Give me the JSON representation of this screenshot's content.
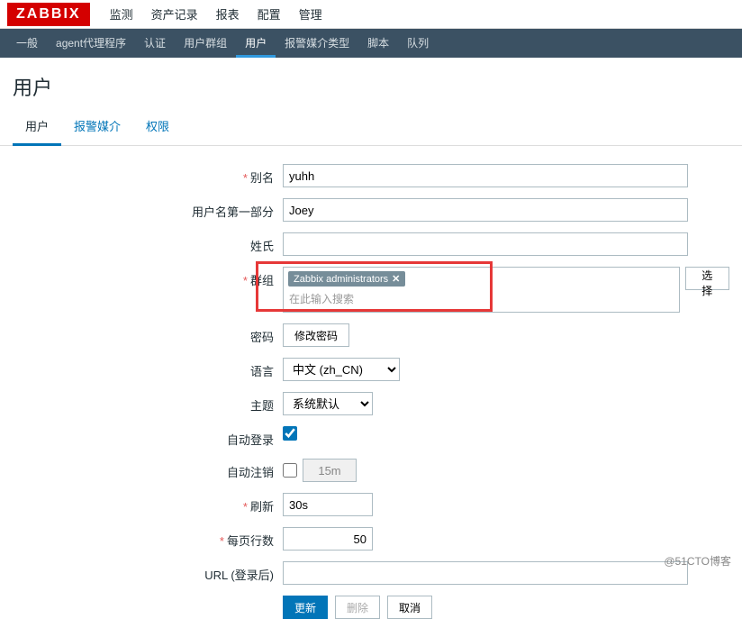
{
  "logo": "ZABBIX",
  "top_menu": {
    "items": [
      "监测",
      "资产记录",
      "报表",
      "配置",
      "管理"
    ],
    "active_index": 4
  },
  "sub_menu": {
    "items": [
      "一般",
      "agent代理程序",
      "认证",
      "用户群组",
      "用户",
      "报警媒介类型",
      "脚本",
      "队列"
    ],
    "active_index": 4
  },
  "page_title": "用户",
  "tabs": {
    "items": [
      "用户",
      "报警媒介",
      "权限"
    ],
    "active_index": 0
  },
  "form": {
    "alias": {
      "label": "别名",
      "value": "yuhh",
      "required": true
    },
    "name_first": {
      "label": "用户名第一部分",
      "value": "Joey"
    },
    "surname": {
      "label": "姓氏",
      "value": ""
    },
    "groups": {
      "label": "群组",
      "required": true,
      "selected": [
        {
          "name": "Zabbix administrators"
        }
      ],
      "placeholder": "在此输入搜索",
      "select_btn": "选择"
    },
    "password": {
      "label": "密码",
      "change_btn": "修改密码"
    },
    "language": {
      "label": "语言",
      "value": "中文 (zh_CN)",
      "options": [
        "中文 (zh_CN)"
      ]
    },
    "theme": {
      "label": "主题",
      "value": "系统默认",
      "options": [
        "系统默认"
      ]
    },
    "autologin": {
      "label": "自动登录",
      "checked": true
    },
    "autologout": {
      "label": "自动注销",
      "checked": false,
      "value": "15m"
    },
    "refresh": {
      "label": "刷新",
      "value": "30s",
      "required": true
    },
    "rows_per_page": {
      "label": "每页行数",
      "value": "50",
      "required": true
    },
    "url": {
      "label": "URL (登录后)",
      "value": ""
    }
  },
  "buttons": {
    "update": "更新",
    "delete": "删除",
    "cancel": "取消"
  },
  "watermark": "@51CTO博客"
}
